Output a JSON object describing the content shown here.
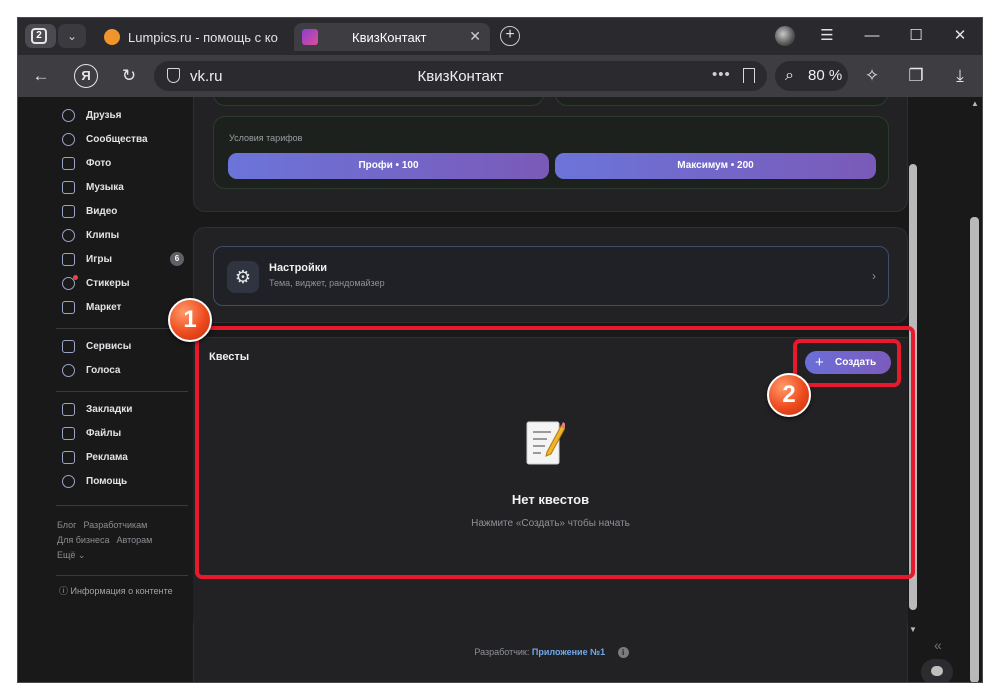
{
  "browser": {
    "tab_count": "2",
    "tabs": [
      {
        "title": "Lumpics.ru - помощь с ко",
        "active": false
      },
      {
        "title": "КвизКонтакт",
        "active": true
      }
    ],
    "address": {
      "domain": "vk.ru",
      "page_title": "КвизКонтакт"
    },
    "zoom": "80 %",
    "window_controls": {
      "menu": "☰",
      "minimize": "—",
      "maximize": "☐",
      "close": "✕"
    }
  },
  "sidebar": {
    "items": [
      {
        "label": "Друзья",
        "icon": "friends-icon"
      },
      {
        "label": "Сообщества",
        "icon": "communities-icon"
      },
      {
        "label": "Фото",
        "icon": "photo-icon"
      },
      {
        "label": "Музыка",
        "icon": "music-icon"
      },
      {
        "label": "Видео",
        "icon": "video-icon"
      },
      {
        "label": "Клипы",
        "icon": "clips-icon"
      },
      {
        "label": "Игры",
        "icon": "games-icon",
        "badge": "6"
      },
      {
        "label": "Стикеры",
        "icon": "stickers-icon"
      },
      {
        "label": "Маркет",
        "icon": "market-icon"
      },
      {
        "label": "Сервисы",
        "icon": "services-icon"
      },
      {
        "label": "Голоса",
        "icon": "votes-icon"
      },
      {
        "label": "Закладки",
        "icon": "bookmarks-icon"
      },
      {
        "label": "Файлы",
        "icon": "files-icon"
      },
      {
        "label": "Реклама",
        "icon": "ads-icon"
      },
      {
        "label": "Помощь",
        "icon": "help-icon"
      }
    ],
    "footer_links": [
      "Блог",
      "Разработчикам",
      "Для бизнеса",
      "Авторам",
      "Ещё ⌄"
    ],
    "content_info": "Информация о контенте"
  },
  "tariffs": {
    "label": "Условия тарифов",
    "buttons": [
      "Профи • 100",
      "Максимум • 200"
    ]
  },
  "settings": {
    "title": "Настройки",
    "subtitle": "Тема, виджет, рандомайзер"
  },
  "quests": {
    "title": "Квесты",
    "create_label": "Создать",
    "empty_title": "Нет квестов",
    "empty_hint": "Нажмите «Создать» чтобы начать"
  },
  "developer": {
    "prefix": "Разработчик:",
    "app_name": "Приложение №1"
  },
  "annotations": {
    "marker_1": "1",
    "marker_2": "2",
    "highlight_color": "#e8192c"
  },
  "colors": {
    "accent_gradient_start": "#6a6fd8",
    "accent_gradient_end": "#7b5bbd",
    "link": "#71aaeb"
  }
}
